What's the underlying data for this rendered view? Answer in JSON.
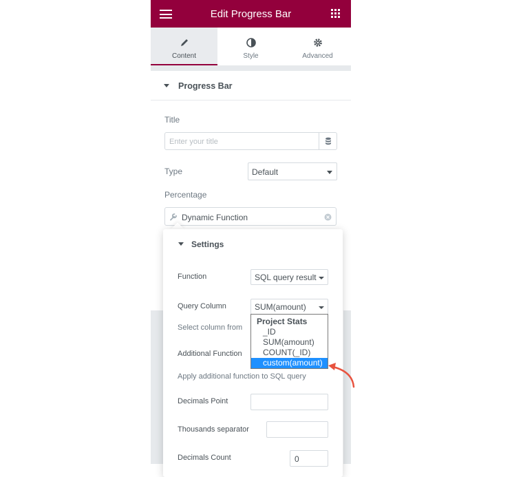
{
  "header": {
    "title": "Edit Progress Bar",
    "menu_icon": "hamburger-icon",
    "grid_icon": "apps-grid-icon"
  },
  "tabs": [
    {
      "label": "Content",
      "icon": "pencil-icon",
      "active": true
    },
    {
      "label": "Style",
      "icon": "half-circle-icon",
      "active": false
    },
    {
      "label": "Advanced",
      "icon": "gear-icon",
      "active": false
    }
  ],
  "section": {
    "title": "Progress Bar"
  },
  "fields": {
    "title_label": "Title",
    "title_placeholder": "Enter your title",
    "type_label": "Type",
    "type_value": "Default",
    "percentage_label": "Percentage",
    "dynamic_value": "Dynamic Function"
  },
  "settings": {
    "title": "Settings",
    "function_label": "Function",
    "function_value": "SQL query result",
    "query_column_label": "Query Column",
    "query_column_value": "SUM(amount)",
    "query_column_desc": "Select column from",
    "additional_function_label": "Additional Function",
    "additional_function_desc": "Apply additional function to SQL query",
    "decimals_point_label": "Decimals Point",
    "thousands_separator_label": "Thousands separator",
    "decimals_count_label": "Decimals Count",
    "decimals_count_value": "0"
  },
  "dropdown": {
    "group": "Project Stats",
    "options": [
      "_ID",
      "SUM(amount)",
      "COUNT(_ID)",
      "custom(amount)"
    ],
    "selected": "custom(amount)"
  },
  "colors": {
    "brand": "#93003c",
    "highlight": "#1e90ff",
    "annotation_arrow": "#e8533f"
  }
}
